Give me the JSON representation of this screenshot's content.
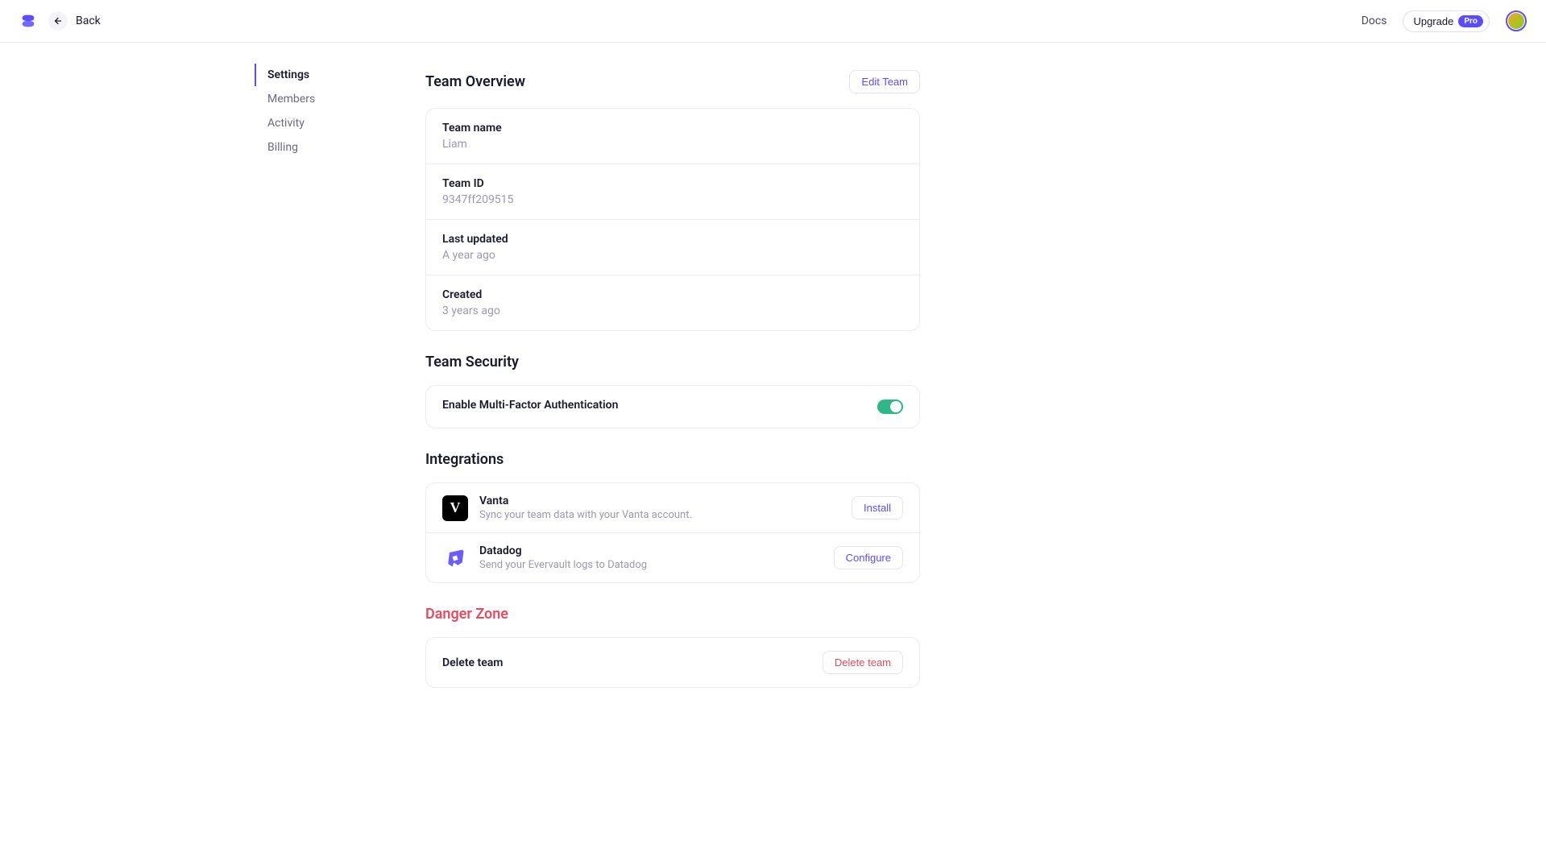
{
  "header": {
    "back_label": "Back",
    "docs_label": "Docs",
    "upgrade_label": "Upgrade",
    "pro_badge": "Pro"
  },
  "sidebar": {
    "items": [
      {
        "label": "Settings",
        "active": true
      },
      {
        "label": "Members",
        "active": false
      },
      {
        "label": "Activity",
        "active": false
      },
      {
        "label": "Billing",
        "active": false
      }
    ]
  },
  "overview": {
    "title": "Team Overview",
    "edit_label": "Edit Team",
    "fields": [
      {
        "label": "Team name",
        "value": "Liam"
      },
      {
        "label": "Team ID",
        "value": "9347ff209515"
      },
      {
        "label": "Last updated",
        "value": "A year ago"
      },
      {
        "label": "Created",
        "value": "3 years ago"
      }
    ]
  },
  "security": {
    "title": "Team Security",
    "mfa_label": "Enable Multi-Factor Authentication",
    "mfa_enabled": true
  },
  "integrations": {
    "title": "Integrations",
    "items": [
      {
        "name": "Vanta",
        "desc": "Sync your team data with your Vanta account.",
        "action": "Install"
      },
      {
        "name": "Datadog",
        "desc": "Send your Evervault logs to Datadog",
        "action": "Configure"
      }
    ]
  },
  "danger": {
    "title": "Danger Zone",
    "delete_label": "Delete team",
    "delete_action": "Delete team"
  }
}
